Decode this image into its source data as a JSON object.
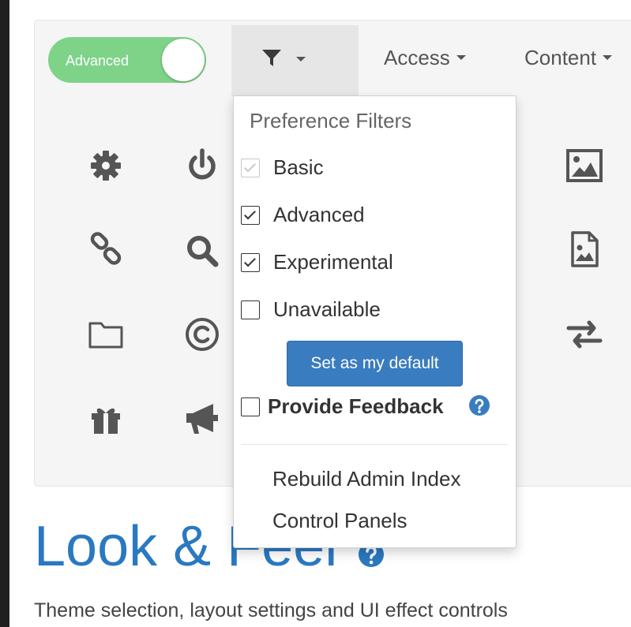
{
  "toggle": {
    "label": "Advanced",
    "state": "on",
    "color": "#7ed389"
  },
  "toolbar": {
    "filter_icon": "filter-icon",
    "menus": [
      {
        "label": "Access"
      },
      {
        "label": "Content"
      }
    ]
  },
  "icons": {
    "left_grid": [
      "gear-icon",
      "power-icon",
      "link-icon",
      "search-icon",
      "folder-icon",
      "copyright-icon",
      "gift-icon",
      "megaphone-icon"
    ],
    "right_column": [
      "image-icon",
      "image-file-icon",
      "exchange-icon"
    ]
  },
  "dropdown": {
    "header": "Preference Filters",
    "filters": [
      {
        "label": "Basic",
        "checked": true,
        "disabled": true
      },
      {
        "label": "Advanced",
        "checked": true,
        "disabled": false
      },
      {
        "label": "Experimental",
        "checked": true,
        "disabled": false
      },
      {
        "label": "Unavailable",
        "checked": false,
        "disabled": false
      }
    ],
    "default_button": "Set as my default",
    "feedback": {
      "label": "Provide Feedback",
      "checked": false
    },
    "links": [
      "Rebuild Admin Index",
      "Control Panels"
    ]
  },
  "page": {
    "title": "Look & Feel",
    "description": "Theme selection, layout settings and UI effect controls"
  },
  "colors": {
    "accent": "#3a7cc0",
    "title": "#2a79c0",
    "toggle_on": "#7ed389",
    "icon": "#555555"
  }
}
